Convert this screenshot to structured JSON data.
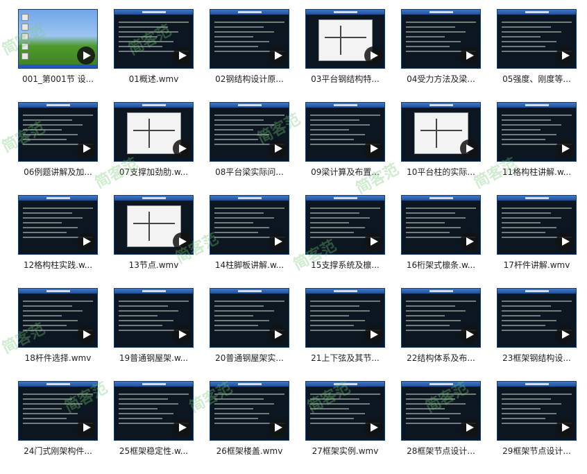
{
  "files": [
    {
      "name": "001_第001节 设...",
      "kind": "desktop"
    },
    {
      "name": "01概述.wmv",
      "kind": "text"
    },
    {
      "name": "02钢结构设计原...",
      "kind": "text"
    },
    {
      "name": "03平台钢结构特...",
      "kind": "diagram"
    },
    {
      "name": "04受力方法及梁...",
      "kind": "text"
    },
    {
      "name": "05强度、刚度等...",
      "kind": "text"
    },
    {
      "name": "06例题讲解及加...",
      "kind": "text"
    },
    {
      "name": "07支撑加劲肋.w...",
      "kind": "diagram"
    },
    {
      "name": "08平台梁实际问...",
      "kind": "text"
    },
    {
      "name": "09梁计算及布置...",
      "kind": "text"
    },
    {
      "name": "10平台柱的实际...",
      "kind": "diagram"
    },
    {
      "name": "11格构柱讲解.w...",
      "kind": "text"
    },
    {
      "name": "12格构柱实践.w...",
      "kind": "text"
    },
    {
      "name": "13节点.wmv",
      "kind": "diagram"
    },
    {
      "name": "14柱脚板讲解.w...",
      "kind": "text"
    },
    {
      "name": "15支撑系统及檩...",
      "kind": "text"
    },
    {
      "name": "16桁架式檩条.w...",
      "kind": "text"
    },
    {
      "name": "17杆件讲解.wmv",
      "kind": "text"
    },
    {
      "name": "18杆件选择.wmv",
      "kind": "text"
    },
    {
      "name": "19普通钢屋架.w...",
      "kind": "text"
    },
    {
      "name": "20普通钢屋架实...",
      "kind": "text"
    },
    {
      "name": "21上下弦及其节...",
      "kind": "text"
    },
    {
      "name": "22结构体系及布...",
      "kind": "text"
    },
    {
      "name": "23框架钢结构设...",
      "kind": "text"
    },
    {
      "name": "24门式刚架构件...",
      "kind": "text"
    },
    {
      "name": "25框架稳定性.w...",
      "kind": "text"
    },
    {
      "name": "26框架楼盖.wmv",
      "kind": "text"
    },
    {
      "name": "27框架实例.wmv",
      "kind": "text"
    },
    {
      "name": "28框架节点设计...",
      "kind": "text"
    },
    {
      "name": "29框架节点设计..."
    }
  ],
  "watermark_text": "简客范"
}
